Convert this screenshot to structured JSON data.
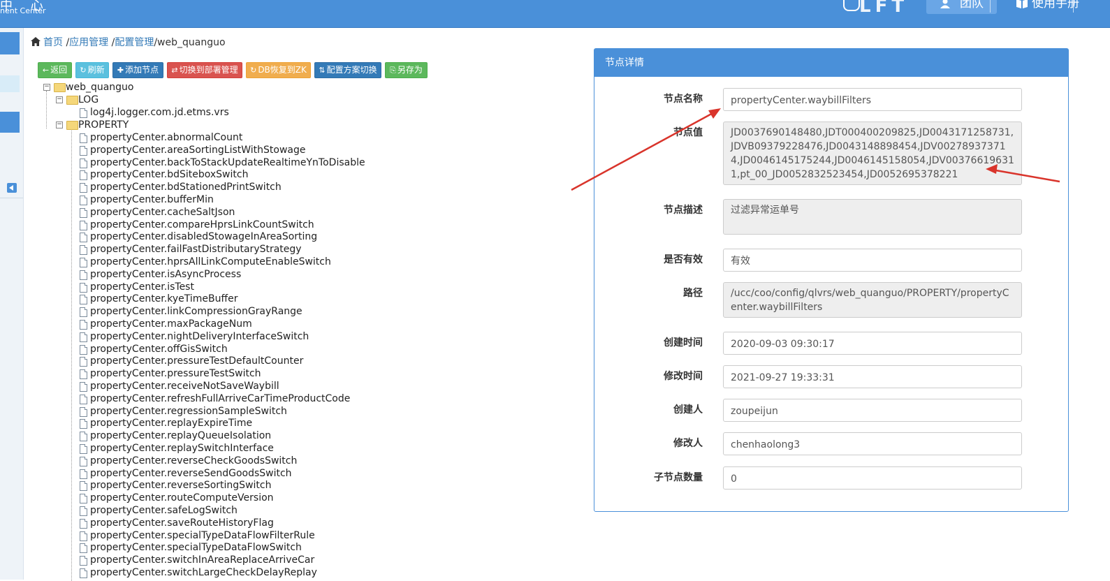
{
  "header": {
    "logo_cn": "中 心",
    "logo_en": "nent Center",
    "brand": "LFT",
    "team_label": "团队",
    "manual_label": "使用手册"
  },
  "breadcrumb": {
    "home": "首页",
    "sep": "/",
    "app_manage": "应用管理",
    "config_manage": "配置管理",
    "current": "/web_quanguo"
  },
  "toolbar": {
    "back": "返回",
    "refresh": "刷新",
    "add_node": "添加节点",
    "switch_deploy": "切换到部署管理",
    "db_restore": "DB恢复到ZK",
    "scheme_switch": "配置方案切换",
    "save_as": "另存为"
  },
  "tree": {
    "root": "web_quanguo",
    "log_folder": "LOG",
    "log_items": [
      "log4j.logger.com.jd.etms.vrs"
    ],
    "property_folder": "PROPERTY",
    "property_items": [
      "propertyCenter.abnormalCount",
      "propertyCenter.areaSortingListWithStowage",
      "propertyCenter.backToStackUpdateRealtimeYnToDisable",
      "propertyCenter.bdSiteboxSwitch",
      "propertyCenter.bdStationedPrintSwitch",
      "propertyCenter.bufferMin",
      "propertyCenter.cacheSaltJson",
      "propertyCenter.compareHprsLinkCountSwitch",
      "propertyCenter.disabledStowageInAreaSorting",
      "propertyCenter.failFastDistributaryStrategy",
      "propertyCenter.hprsAllLinkComputeEnableSwitch",
      "propertyCenter.isAsyncProcess",
      "propertyCenter.isTest",
      "propertyCenter.kyeTimeBuffer",
      "propertyCenter.linkCompressionGrayRange",
      "propertyCenter.maxPackageNum",
      "propertyCenter.nightDeliveryInterfaceSwitch",
      "propertyCenter.offGisSwitch",
      "propertyCenter.pressureTestDefaultCounter",
      "propertyCenter.pressureTestSwitch",
      "propertyCenter.receiveNotSaveWaybill",
      "propertyCenter.refreshFullArriveCarTimeProductCode",
      "propertyCenter.regressionSampleSwitch",
      "propertyCenter.replayExpireTime",
      "propertyCenter.replayQueueIsolation",
      "propertyCenter.replaySwitchInterface",
      "propertyCenter.reverseCheckGoodsSwitch",
      "propertyCenter.reverseSendGoodsSwitch",
      "propertyCenter.reverseSortingSwitch",
      "propertyCenter.routeComputeVersion",
      "propertyCenter.safeLogSwitch",
      "propertyCenter.saveRouteHistoryFlag",
      "propertyCenter.specialTypeDataFlowFilterRule",
      "propertyCenter.specialTypeDataFlowSwitch",
      "propertyCenter.switchInAreaReplaceArriveCar",
      "propertyCenter.switchLargeCheckDelayReplay"
    ]
  },
  "detail": {
    "title": "节点详情",
    "fields": [
      {
        "label": "节点名称",
        "value": "propertyCenter.waybillFilters"
      },
      {
        "label": "节点值",
        "value": "JD0037690148480,JDT000400209825,JD0043171258731,JDVB09379228476,JD0043148898454,JDV002789373714,JD0046145175244,JD0046145158054,JDV003766196311,pt_00_JD0052832523454,JD0052695378221"
      },
      {
        "label": "节点描述",
        "value": "过滤异常运单号"
      },
      {
        "label": "是否有效",
        "value": "有效"
      },
      {
        "label": "路径",
        "value": "/ucc/coo/config/qlvrs/web_quanguo/PROPERTY/propertyCenter.waybillFilters"
      },
      {
        "label": "创建时间",
        "value": "2020-09-03 09:30:17"
      },
      {
        "label": "修改时间",
        "value": "2021-09-27 19:33:31"
      },
      {
        "label": "创建人",
        "value": "zoupeijun"
      },
      {
        "label": "修改人",
        "value": "chenhaolong3"
      },
      {
        "label": "子节点数量",
        "value": "0"
      }
    ]
  },
  "colors": {
    "header": "#4a90d9",
    "annotation_arrow": "#d9342b"
  }
}
